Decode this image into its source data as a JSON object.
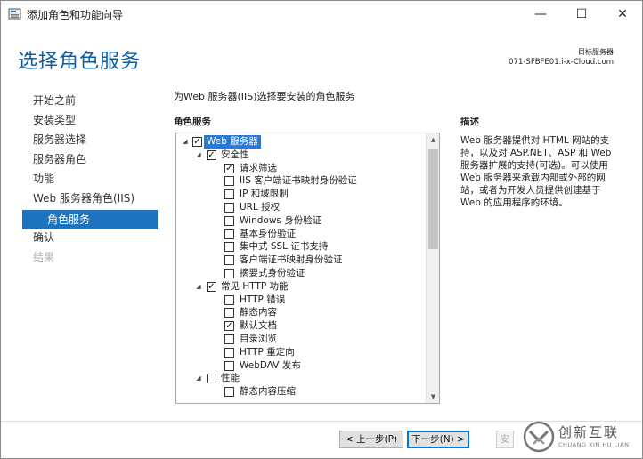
{
  "window": {
    "title": "添加角色和功能向导",
    "controls": {
      "minimize": "—",
      "maximize": "☐",
      "close": "✕"
    }
  },
  "header": {
    "page_title": "选择角色服务",
    "destination_label": "目标服务器",
    "destination_server": "071-SFBFE01.i-x-Cloud.com"
  },
  "nav": {
    "items": [
      {
        "label": "开始之前",
        "state": "normal"
      },
      {
        "label": "安装类型",
        "state": "normal"
      },
      {
        "label": "服务器选择",
        "state": "normal"
      },
      {
        "label": "服务器角色",
        "state": "normal"
      },
      {
        "label": "功能",
        "state": "normal"
      },
      {
        "label": "Web 服务器角色(IIS)",
        "state": "normal"
      },
      {
        "label": "角色服务",
        "state": "active"
      },
      {
        "label": "确认",
        "state": "normal"
      },
      {
        "label": "结果",
        "state": "disabled"
      }
    ]
  },
  "main": {
    "instruction": "为Web 服务器(IIS)选择要安装的角色服务",
    "roles_header": "角色服务",
    "description_header": "描述",
    "description_text": "Web 服务器提供对 HTML 网站的支持，以及对 ASP.NET、ASP 和 Web 服务器扩展的支持(可选)。可以使用 Web 服务器来承载内部或外部的网站，或者为开发人员提供创建基于 Web 的应用程序的环境。",
    "tree": [
      {
        "label": "Web 服务器",
        "level": 0,
        "expander": "◢",
        "checked": true,
        "selected": true
      },
      {
        "label": "安全性",
        "level": 1,
        "expander": "◢",
        "checked": true
      },
      {
        "label": "请求筛选",
        "level": 2,
        "checked": true
      },
      {
        "label": "IIS 客户端证书映射身份验证",
        "level": 2,
        "checked": false
      },
      {
        "label": "IP 和域限制",
        "level": 2,
        "checked": false
      },
      {
        "label": "URL 授权",
        "level": 2,
        "checked": false
      },
      {
        "label": "Windows 身份验证",
        "level": 2,
        "checked": false
      },
      {
        "label": "基本身份验证",
        "level": 2,
        "checked": false
      },
      {
        "label": "集中式 SSL 证书支持",
        "level": 2,
        "checked": false
      },
      {
        "label": "客户端证书映射身份验证",
        "level": 2,
        "checked": false
      },
      {
        "label": "摘要式身份验证",
        "level": 2,
        "checked": false
      },
      {
        "label": "常见 HTTP 功能",
        "level": 1,
        "expander": "◢",
        "checked": true
      },
      {
        "label": "HTTP 错误",
        "level": 2,
        "checked": false
      },
      {
        "label": "静态内容",
        "level": 2,
        "checked": false
      },
      {
        "label": "默认文档",
        "level": 2,
        "checked": true
      },
      {
        "label": "目录浏览",
        "level": 2,
        "checked": false
      },
      {
        "label": "HTTP 重定向",
        "level": 2,
        "checked": false
      },
      {
        "label": "WebDAV 发布",
        "level": 2,
        "checked": false
      },
      {
        "label": "性能",
        "level": 1,
        "expander": "◢",
        "checked": false
      },
      {
        "label": "静态内容压缩",
        "level": 2,
        "checked": false
      }
    ],
    "scroll": {
      "up": "▲",
      "down": "▼"
    }
  },
  "footer": {
    "prev_label": "< 上一步(P)",
    "next_label": "下一步(N) >",
    "install_label": "安"
  },
  "watermark": {
    "brand": "创新互联",
    "sub": "CHUANG XIN HU LIAN"
  },
  "colors": {
    "title_blue": "#0b5ea8",
    "active_nav": "#1e73be",
    "selection": "#2b79d0"
  }
}
